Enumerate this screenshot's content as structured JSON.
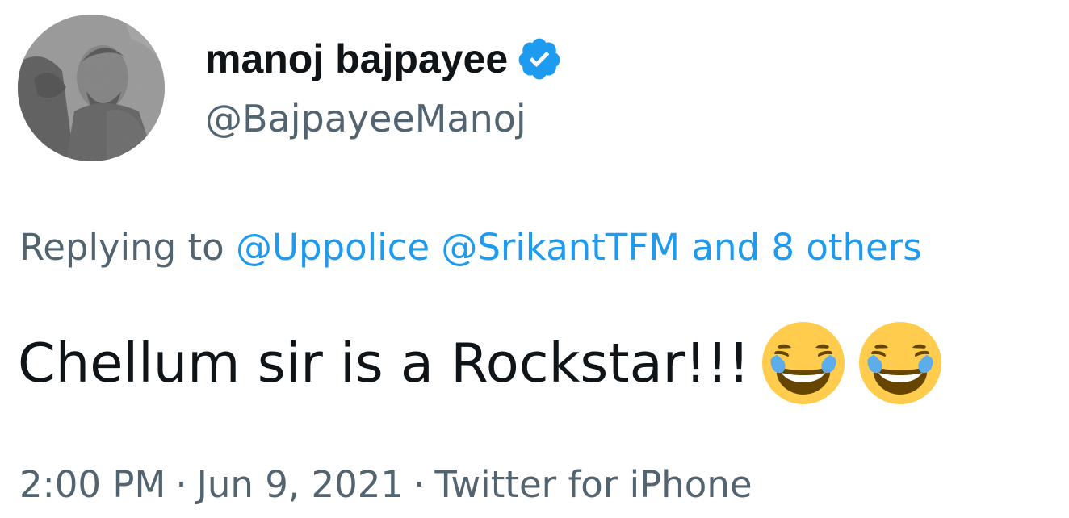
{
  "user": {
    "display_name": "manoj bajpayee",
    "handle": "@BajpayeeManoj",
    "verified": true
  },
  "reply": {
    "prefix": "Replying to",
    "mentions": [
      "@Uppolice",
      "@SrikantTFM"
    ],
    "others": "and 8 others"
  },
  "tweet": {
    "text": "Chellum sir is a Rockstar!!!",
    "emojis": [
      "face-with-tears-of-joy",
      "face-with-tears-of-joy"
    ]
  },
  "meta": {
    "time": "2:00 PM",
    "separator": "·",
    "date": "Jun 9, 2021",
    "source": "Twitter for iPhone"
  },
  "colors": {
    "text_primary": "#0f1419",
    "text_secondary": "#536471",
    "link": "#1d9bf0",
    "verified_badge": "#1d9bf0"
  }
}
